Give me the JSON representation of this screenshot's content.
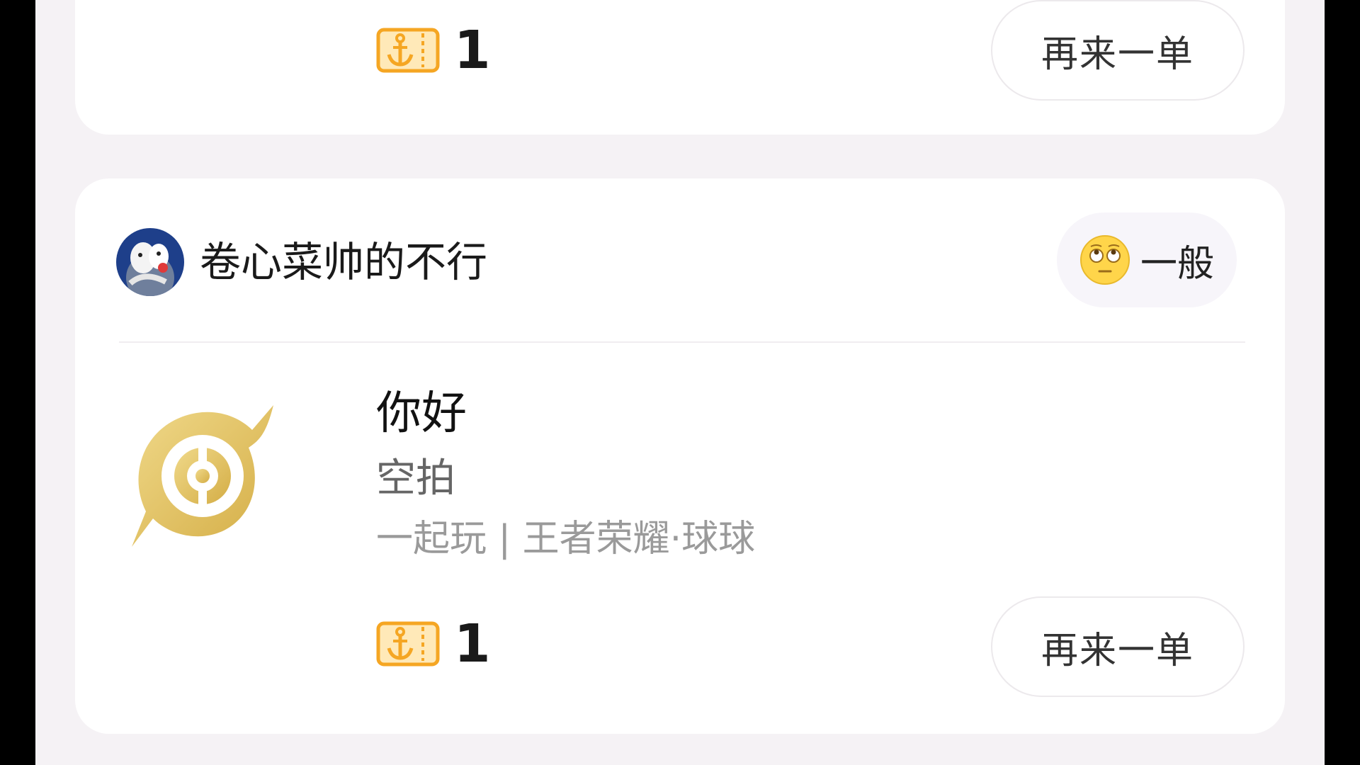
{
  "orders": [
    {
      "ticket_count": "1",
      "reorder_label": "再来一单"
    },
    {
      "user": {
        "name": "卷心菜帅的不行"
      },
      "rating": {
        "emoji": "rolling-eyes-emoji",
        "label": "一般"
      },
      "service": {
        "title": "你好",
        "type": "空拍",
        "tags": "一起玩 | 王者荣耀·球球"
      },
      "ticket_count": "1",
      "reorder_label": "再来一单"
    }
  ],
  "colors": {
    "page_bg": "#f5f2f5",
    "card_bg": "#ffffff",
    "ticket_orange": "#f5a623",
    "ticket_fill": "#ffe9b8",
    "logo_gold": "#e2c266"
  }
}
